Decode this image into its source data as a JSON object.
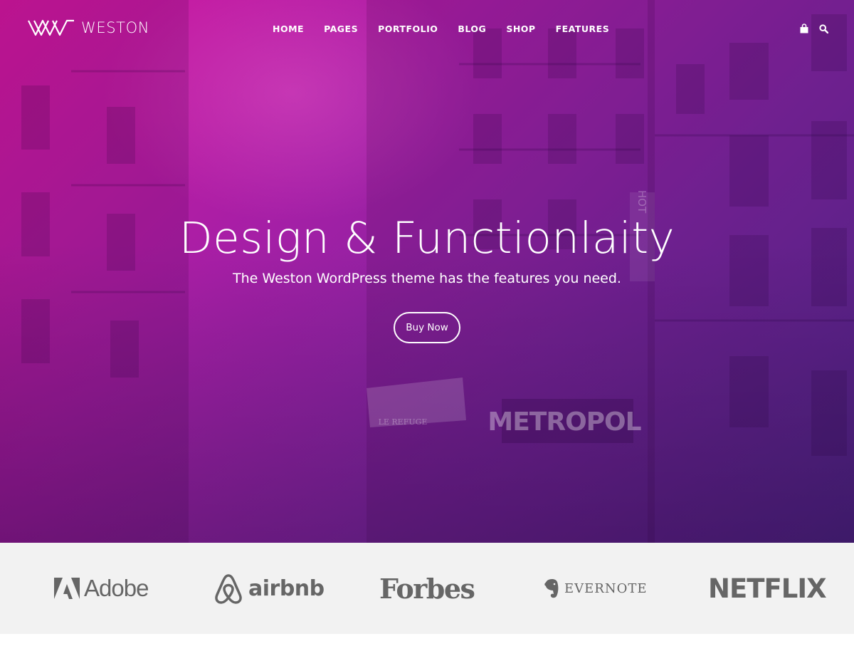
{
  "header": {
    "logo_text": "WESTON",
    "nav": [
      {
        "label": "HOME"
      },
      {
        "label": "PAGES"
      },
      {
        "label": "PORTFOLIO"
      },
      {
        "label": "BLOG"
      },
      {
        "label": "SHOP"
      },
      {
        "label": "FEATURES"
      }
    ],
    "icons": {
      "cart": "shopping-bag-icon",
      "search": "search-icon"
    }
  },
  "hero": {
    "title": "Design & Functionlaity",
    "subtitle": "The Weston WordPress theme has the features you need.",
    "cta_label": "Buy Now",
    "gradient_colors": [
      "#d4179f",
      "#a61fa6",
      "#7a269f",
      "#4e2a8f"
    ],
    "background_signs": {
      "hotel": "HOT",
      "metropol": "METROPOL",
      "awning": "LE REFUGE"
    }
  },
  "brands": {
    "background": "#f2f2f2",
    "logo_color": "#666666",
    "items": [
      {
        "name": "Adobe",
        "icon": "adobe-logo-icon"
      },
      {
        "name": "airbnb",
        "icon": "airbnb-logo-icon"
      },
      {
        "name": "Forbes"
      },
      {
        "name": "EVERNOTE",
        "icon": "evernote-elephant-icon"
      },
      {
        "name": "NETFLIX"
      }
    ]
  }
}
